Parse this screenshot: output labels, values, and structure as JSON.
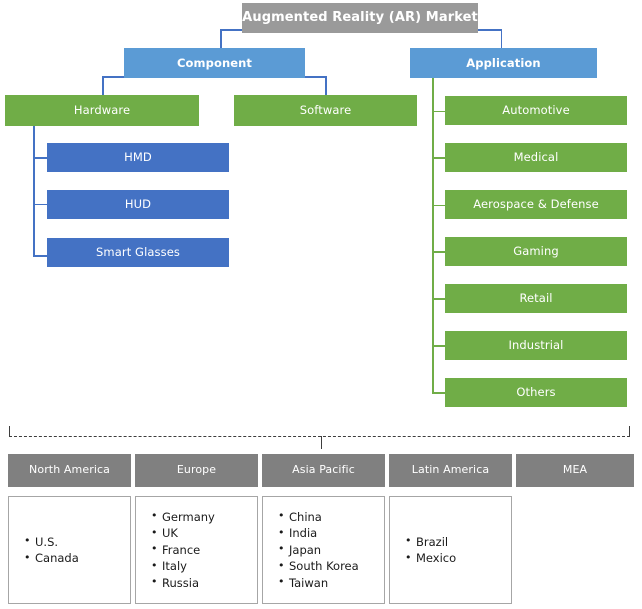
{
  "diagram": {
    "title": "Augmented Reality (AR) Market",
    "branches": {
      "component": {
        "label": "Component",
        "children": [
          {
            "label": "Hardware",
            "children": [
              {
                "label": "HMD"
              },
              {
                "label": "HUD"
              },
              {
                "label": "Smart Glasses"
              }
            ]
          },
          {
            "label": "Software",
            "children": []
          }
        ]
      },
      "application": {
        "label": "Application",
        "children": [
          {
            "label": "Automotive"
          },
          {
            "label": "Medical"
          },
          {
            "label": "Aerospace & Defense"
          },
          {
            "label": "Gaming"
          },
          {
            "label": "Retail"
          },
          {
            "label": "Industrial"
          },
          {
            "label": "Others"
          }
        ]
      }
    },
    "regions": [
      {
        "name": "North America",
        "countries": [
          "U.S.",
          "Canada"
        ]
      },
      {
        "name": "Europe",
        "countries": [
          "Germany",
          "UK",
          "France",
          "Italy",
          "Russia"
        ]
      },
      {
        "name": "Asia Pacific",
        "countries": [
          "China",
          "India",
          "Japan",
          "South Korea",
          "Taiwan"
        ]
      },
      {
        "name": "Latin America",
        "countries": [
          "Brazil",
          "Mexico"
        ]
      },
      {
        "name": "MEA",
        "countries": []
      }
    ],
    "colors": {
      "title_gray": "#9a9a9a",
      "level1_blue": "#5B9BD5",
      "level2_green": "#70AD47",
      "level3_blue": "#4472C4",
      "region_gray": "#808080",
      "connector_blue": "#4472C4",
      "connector_green": "#70AD47",
      "dashed_line": "#3d3d3d"
    }
  }
}
